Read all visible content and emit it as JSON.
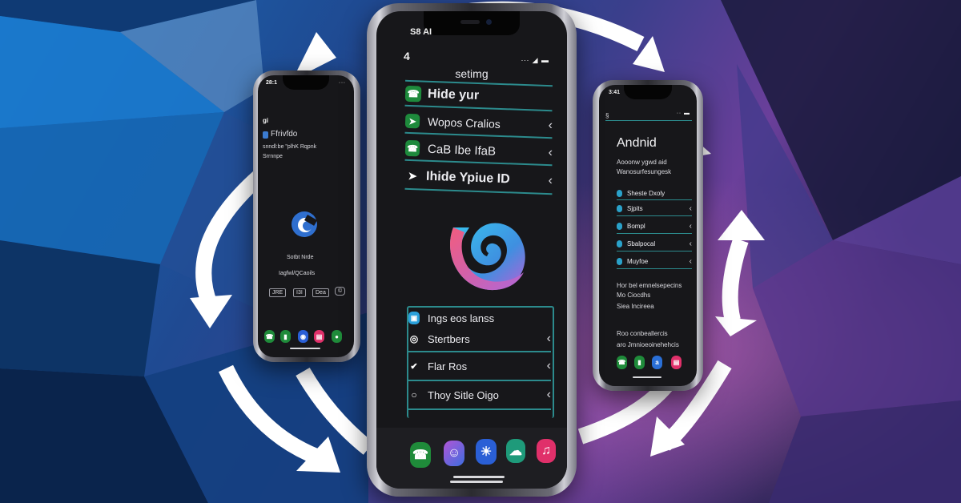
{
  "scene": {
    "description": "Three smartphones surrounded by circular white sync arrows on a blue-to-purple geometric background",
    "colors": {
      "bg_left": "#1b5fa8",
      "bg_mid": "#2c3f86",
      "bg_right": "#6a3f9a",
      "accent_teal": "#2c8b8d",
      "arrow": "#ffffff",
      "screen": "#17171a"
    }
  },
  "center_phone": {
    "status_time": "S8 AI",
    "status_icons": "∙∙∙ ◢ ▬",
    "back_label": "4",
    "title": "setimg",
    "menu_items": [
      {
        "icon": "phone-icon",
        "icon_glyph": "☎",
        "icon_color": "#1e8a3c",
        "label": "Hide yur",
        "chevron": ""
      },
      {
        "icon": "send-icon",
        "icon_glyph": "➤",
        "icon_color": "#1e8a3c",
        "label": "Wopos Cralios",
        "chevron": "‹"
      },
      {
        "icon": "phone-icon",
        "icon_glyph": "☎",
        "icon_color": "#1e8a3c",
        "label": "CaB Ibe IfaB",
        "chevron": "‹"
      },
      {
        "icon": "send-icon",
        "icon_glyph": "➤",
        "icon_color": "transparent",
        "label": "Ihide Ypiue ID",
        "chevron": "‹"
      }
    ],
    "logo": "spiral-logo",
    "lower_items": [
      {
        "icon": "app-icon",
        "icon_glyph": "▣",
        "label": "Ings eos lanss",
        "chevron": ""
      },
      {
        "icon": "instagram-icon",
        "icon_glyph": "◎",
        "label": "Stertbers",
        "chevron": "‹"
      },
      {
        "icon": "check-icon",
        "icon_glyph": "✔",
        "label": "Flar Ros",
        "chevron": "‹"
      },
      {
        "icon": "circle-icon",
        "icon_glyph": "○",
        "label": "Thoy Sitle Oigo",
        "chevron": "‹"
      }
    ],
    "dock": [
      {
        "name": "phone-app-icon",
        "glyph": "☎",
        "color": "#1f8b3a"
      },
      {
        "name": "contacts-app-icon",
        "glyph": "☺",
        "color": "#7a4fd0"
      },
      {
        "name": "photos-app-icon",
        "glyph": "☀",
        "color": "#2a5fd6"
      },
      {
        "name": "chat-app-icon",
        "glyph": "☁",
        "color": "#1e9a7a"
      },
      {
        "name": "music-app-icon",
        "glyph": "♫",
        "color": "#e0306a"
      }
    ]
  },
  "left_phone": {
    "status_time": "28:1",
    "status_icons": "∙∙∙",
    "back_label": "gi",
    "title": "Ffrivfdo",
    "subtitle_line1": "snndl:be \"plhK Rqpnk",
    "subtitle_line2": "Srrnnpe",
    "logo": "g-logo",
    "caption1": "Sotbt Nrde",
    "caption2": "Iagfwl/QCaoils",
    "buttons": [
      "JRE",
      "I3I",
      "Dea",
      "©"
    ],
    "dock": [
      {
        "name": "phone-app-icon",
        "glyph": "☎",
        "color": "#1f8b3a"
      },
      {
        "name": "messages-app-icon",
        "glyph": "▮",
        "color": "#1f8b3a"
      },
      {
        "name": "maps-app-icon",
        "glyph": "◉",
        "color": "#2a5fd6"
      },
      {
        "name": "files-app-icon",
        "glyph": "▤",
        "color": "#e0306a"
      },
      {
        "name": "chat-app-icon",
        "glyph": "●",
        "color": "#1f8b3a"
      }
    ]
  },
  "right_phone": {
    "status_time": "3:41",
    "status_icons": "∙∙ ▬",
    "back_label": "§",
    "title": "Andnid",
    "subtitle_line1": "Aooonw ygwd aid",
    "subtitle_line2": "Wanosurfesungesk",
    "menu_items": [
      {
        "label": "Sheste Dxoly",
        "chevron": ""
      },
      {
        "label": "Sjpits",
        "chevron": "‹"
      },
      {
        "label": "Bompl",
        "chevron": "‹"
      },
      {
        "label": "Sbalpocal",
        "chevron": "‹"
      },
      {
        "label": "Muyfoe",
        "chevron": "‹"
      }
    ],
    "para1": [
      "Hor bel emnelsepecins",
      "Mo Ciocdhs",
      "Siea Incireea"
    ],
    "para2": [
      "Roo conbeallercis",
      "aro Jmnioeoinehehcis"
    ],
    "dock": [
      {
        "name": "phone-app-icon",
        "glyph": "☎",
        "color": "#1f8b3a"
      },
      {
        "name": "messages-app-icon",
        "glyph": "▮",
        "color": "#1f8b3a"
      },
      {
        "name": "files-app-icon",
        "glyph": "a",
        "color": "#2a6fd6"
      },
      {
        "name": "store-app-icon",
        "glyph": "▤",
        "color": "#e0306a"
      }
    ]
  }
}
